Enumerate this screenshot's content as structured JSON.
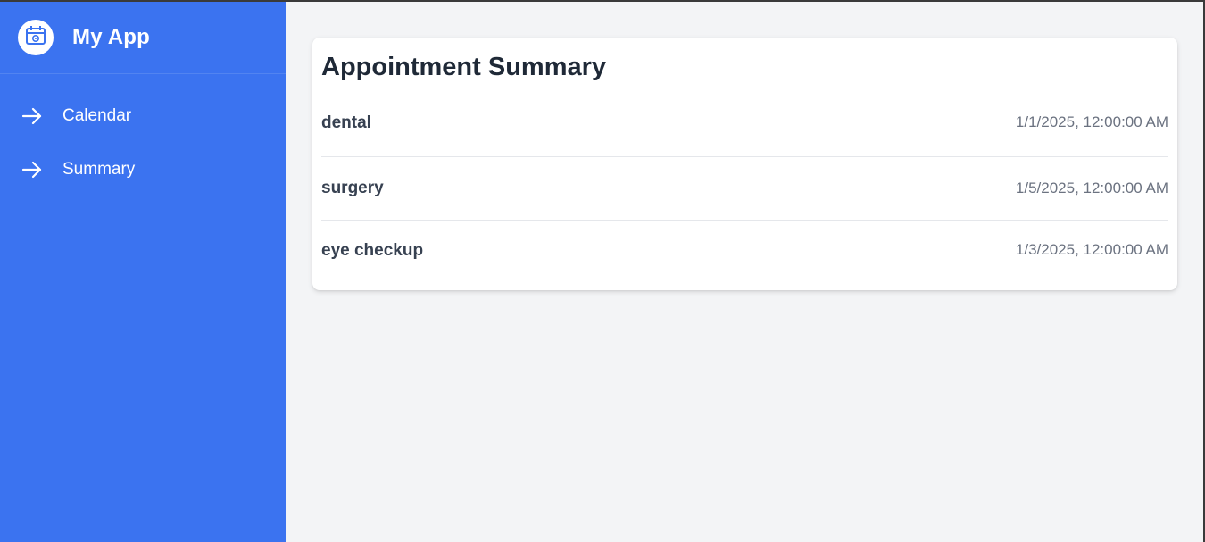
{
  "app": {
    "title": "My App",
    "logo_icon": "calendar-icon"
  },
  "sidebar": {
    "items": [
      {
        "label": "Calendar",
        "icon": "arrow-right-icon"
      },
      {
        "label": "Summary",
        "icon": "arrow-right-icon"
      }
    ]
  },
  "main": {
    "title": "Appointment Summary",
    "appointments": [
      {
        "name": "dental",
        "date": "1/1/2025, 12:00:00 AM"
      },
      {
        "name": "surgery",
        "date": "1/5/2025, 12:00:00 AM"
      },
      {
        "name": "eye checkup",
        "date": "1/3/2025, 12:00:00 AM"
      }
    ]
  },
  "colors": {
    "sidebar": "#3b73f0",
    "background": "#f3f4f6",
    "card": "#ffffff"
  }
}
